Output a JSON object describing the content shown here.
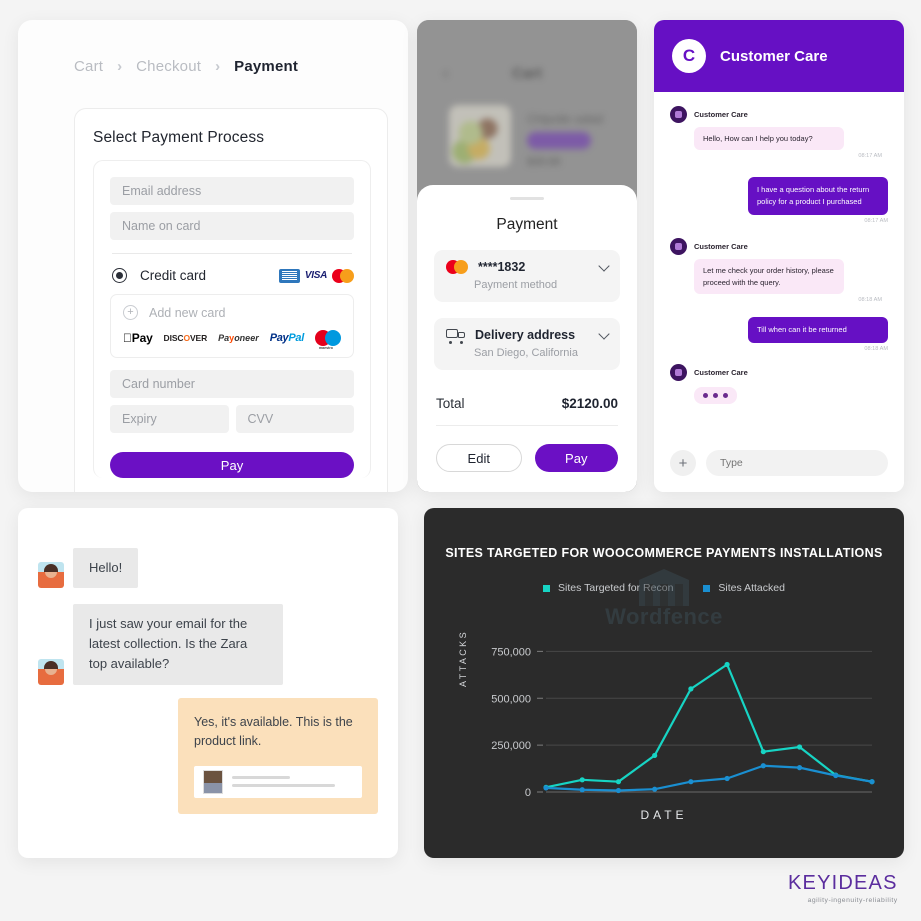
{
  "checkout": {
    "breadcrumb": [
      {
        "label": "Cart",
        "active": false
      },
      {
        "label": "Checkout",
        "active": false
      },
      {
        "label": "Payment",
        "active": true
      }
    ],
    "separator": "›",
    "form_title": "Select Payment Process",
    "fields": {
      "email_placeholder": "Email address",
      "name_placeholder": "Name on card",
      "card_number_placeholder": "Card number",
      "expiry_placeholder": "Expiry",
      "cvv_placeholder": "CVV"
    },
    "credit_card_label": "Credit card",
    "card_brands": [
      "amex",
      "visa",
      "mastercard"
    ],
    "add_new_card_label": "Add new card",
    "wallets": [
      "Apple Pay",
      "DISCOVER",
      "Payoneer",
      "PayPal",
      "Maestro"
    ],
    "pay_button": "Pay",
    "accent_color": "#6b10c4"
  },
  "mobile": {
    "background_screen": {
      "title": "Cart",
      "item_name": "Chipotle salad",
      "item_price": "$20.00"
    },
    "sheet_title": "Payment",
    "options": [
      {
        "main": "****1832",
        "sub": "Payment method",
        "icon": "mastercard-icon"
      },
      {
        "main": "Delivery address",
        "sub": "San Diego, California",
        "icon": "truck-icon"
      }
    ],
    "total_label": "Total",
    "total_value": "$2120.00",
    "edit_button": "Edit",
    "pay_button": "Pay"
  },
  "care": {
    "header_title": "Customer Care",
    "avatar_initial": "C",
    "agent_name": "Customer Care",
    "messages": [
      {
        "from": "agent",
        "text": "Hello, How can I help you today?",
        "time": "08:17 AM"
      },
      {
        "from": "user",
        "text": "I have a question about the return policy for a product I purchased",
        "time": "08:17 AM"
      },
      {
        "from": "agent",
        "text": "Let me check your order history, please proceed with the query.",
        "time": "08:18 AM"
      },
      {
        "from": "user",
        "text": "Till when can it be returned",
        "time": "08:18 AM"
      }
    ],
    "typing_indicator": true,
    "input_placeholder": "Type",
    "add_button": "+",
    "header_color": "#6610c4"
  },
  "zara": {
    "messages": [
      {
        "from": "customer",
        "text": "Hello!"
      },
      {
        "from": "customer",
        "text": "I just saw your email for the latest collection. Is the Zara top available?"
      },
      {
        "from": "agent",
        "text": "Yes, it's available. This is the product link."
      }
    ],
    "link_card": {
      "has_thumbnail": true
    }
  },
  "logo": {
    "name": "KEYIDEAS",
    "tagline": "agility-ingenuity-reliability"
  },
  "chart_data": {
    "type": "line",
    "title": "SITES TARGETED FOR WOOCOMMERCE PAYMENTS INSTALLATIONS",
    "xlabel": "DATE",
    "ylabel": "ATTACKS",
    "ylim": [
      0,
      800000
    ],
    "yticks": [
      0,
      250000,
      500000,
      750000
    ],
    "ytick_labels": [
      "0",
      "250,000",
      "500,000",
      "750,000"
    ],
    "grid": true,
    "legend_position": "top",
    "watermark": "Wordfence",
    "x": [
      1,
      2,
      3,
      4,
      5,
      6,
      7,
      8,
      9,
      10
    ],
    "series": [
      {
        "name": "Sites Targeted for Recon",
        "color": "#17d4c4",
        "values": [
          25000,
          65000,
          55000,
          195000,
          550000,
          680000,
          215000,
          240000,
          90000,
          55000
        ]
      },
      {
        "name": "Sites Attacked",
        "color": "#1a8fd1",
        "values": [
          22000,
          12000,
          8000,
          15000,
          55000,
          72000,
          140000,
          130000,
          88000,
          55000
        ]
      }
    ]
  }
}
